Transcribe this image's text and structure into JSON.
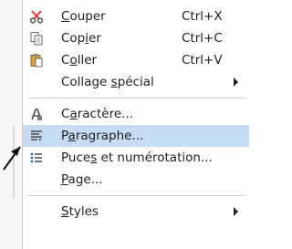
{
  "menu": {
    "items": [
      {
        "id": "cut",
        "icon": "scissors-icon",
        "pre": "",
        "accel": "C",
        "post": "ouper",
        "shortcut": "Ctrl+X"
      },
      {
        "id": "copy",
        "icon": "copy-icon",
        "pre": "Cop",
        "accel": "i",
        "post": "er",
        "shortcut": "Ctrl+C"
      },
      {
        "id": "paste",
        "icon": "paste-icon",
        "pre": "C",
        "accel": "o",
        "post": "ller",
        "shortcut": "Ctrl+V"
      },
      {
        "id": "paste-special",
        "icon": "",
        "pre": "Collage ",
        "accel": "s",
        "post": "pécial",
        "shortcut": "",
        "submenu": true
      },
      {
        "id": "character",
        "icon": "character-icon",
        "pre": "C",
        "accel": "a",
        "post": "ractère...",
        "shortcut": ""
      },
      {
        "id": "paragraph",
        "icon": "paragraph-icon",
        "pre": "P",
        "accel": "a",
        "post": "ragraphe...",
        "shortcut": "",
        "highlighted": true
      },
      {
        "id": "bullets",
        "icon": "bullets-numbering-icon",
        "pre": "Puce",
        "accel": "s",
        "post": " et numérotation...",
        "shortcut": ""
      },
      {
        "id": "page",
        "icon": "",
        "pre": "",
        "accel": "P",
        "post": "age...",
        "shortcut": ""
      },
      {
        "id": "styles",
        "icon": "",
        "pre": "",
        "accel": "S",
        "post": "tyles",
        "shortcut": "",
        "submenu": true
      }
    ]
  },
  "colors": {
    "highlight": "#c6dcf3",
    "text": "#1e1e1e",
    "scissors": "#e53935"
  }
}
